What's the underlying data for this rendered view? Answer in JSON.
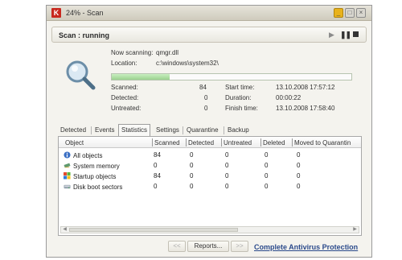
{
  "window": {
    "title": "24% - Scan",
    "app_logo_letter": "K"
  },
  "status": {
    "text": "Scan : running"
  },
  "scan_info": {
    "now_scanning_label": "Now scanning:",
    "now_scanning_value": "qmgr.dll",
    "location_label": "Location:",
    "location_value": "c:\\windows\\system32\\"
  },
  "progress": {
    "percent": 24
  },
  "stats": {
    "scanned_label": "Scanned:",
    "scanned_value": "84",
    "detected_label": "Detected:",
    "detected_value": "0",
    "untreated_label": "Untreated:",
    "untreated_value": "0",
    "start_label": "Start time:",
    "start_value": "13.10.2008 17:57:12",
    "duration_label": "Duration:",
    "duration_value": "00:00:22",
    "finish_label": "Finish time:",
    "finish_value": "13.10.2008 17:58:40"
  },
  "tabs": [
    "Detected",
    "Events",
    "Statistics",
    "Settings",
    "Quarantine",
    "Backup"
  ],
  "table": {
    "headers": [
      "Object",
      "Scanned",
      "Detected",
      "Untreated",
      "Deleted",
      "Moved to Quarantin"
    ],
    "rows": [
      {
        "object": "All objects",
        "icon": "info-icon",
        "scanned": "84",
        "detected": "0",
        "untreated": "0",
        "deleted": "0",
        "moved": "0"
      },
      {
        "object": "System memory",
        "icon": "memory-chip-icon",
        "scanned": "0",
        "detected": "0",
        "untreated": "0",
        "deleted": "0",
        "moved": "0"
      },
      {
        "object": "Startup objects",
        "icon": "startup-icon",
        "scanned": "84",
        "detected": "0",
        "untreated": "0",
        "deleted": "0",
        "moved": "0"
      },
      {
        "object": "Disk boot sectors",
        "icon": "disk-icon",
        "scanned": "0",
        "detected": "0",
        "untreated": "0",
        "deleted": "0",
        "moved": "0"
      }
    ]
  },
  "footer": {
    "prev_label": "<<",
    "reports_label": "Reports...",
    "next_label": ">>",
    "link_text": "Complete Antivirus Protection"
  },
  "colors": {
    "accent_link": "#2b4a8b",
    "logo_red": "#c8281e",
    "progress_green": "#9bd28f"
  }
}
